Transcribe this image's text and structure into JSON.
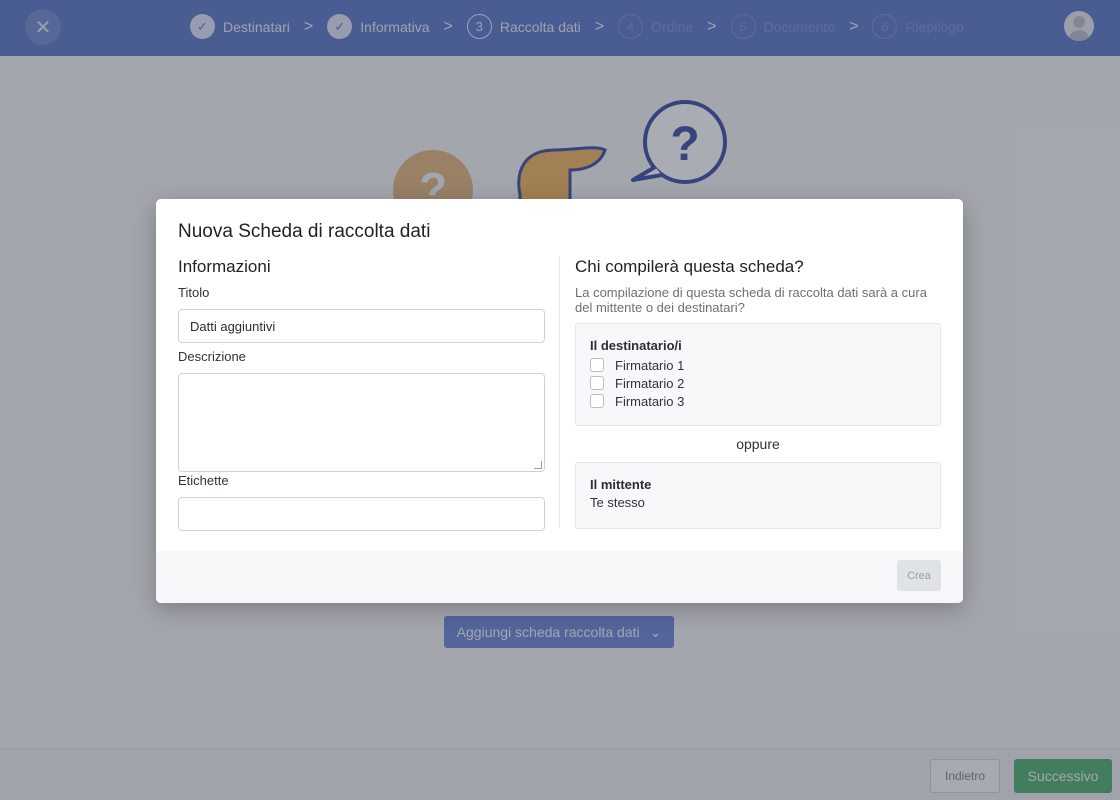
{
  "header": {
    "close_icon": "close-icon",
    "steps": [
      {
        "number": "1",
        "label": "Destinatari",
        "state": "done"
      },
      {
        "number": "2",
        "label": "Informativa",
        "state": "done"
      },
      {
        "number": "3",
        "label": "Raccolta dati",
        "state": "current"
      },
      {
        "number": "4",
        "label": "Ordine",
        "state": "todo"
      },
      {
        "number": "5",
        "label": "Documento",
        "state": "todo"
      },
      {
        "number": "6",
        "label": "Riepilogo",
        "state": "todo"
      }
    ],
    "separator": ">",
    "check_glyph": "✓",
    "avatar_icon": "user-avatar-icon"
  },
  "background": {
    "add_button_label": "Aggiungi scheda raccolta dati",
    "back_label": "Indietro",
    "next_label": "Successivo"
  },
  "modal": {
    "title": "Nuova Scheda di raccolta dati",
    "left": {
      "section_title": "Informazioni",
      "title_label": "Titolo",
      "title_value": "Datti aggiuntivi",
      "description_label": "Descrizione",
      "description_value": "",
      "tags_label": "Etichette",
      "tags_value": ""
    },
    "right": {
      "section_title": "Chi compilerà questa scheda?",
      "description": "La compilazione di questa scheda di raccolta dati sarà a cura del mittente o dei destinatari?",
      "recipients_title": "Il destinatario/i",
      "recipients": [
        {
          "label": "Firmatario 1",
          "checked": false
        },
        {
          "label": "Firmatario 2",
          "checked": false
        },
        {
          "label": "Firmatario 3",
          "checked": false
        }
      ],
      "or_label": "oppure",
      "sender_title": "Il mittente",
      "sender_value": "Te stesso"
    },
    "create_label": "Crea"
  },
  "colors": {
    "header_bg": "#5b77c7",
    "primary": "#6b86d6",
    "success": "#4caf6b"
  }
}
